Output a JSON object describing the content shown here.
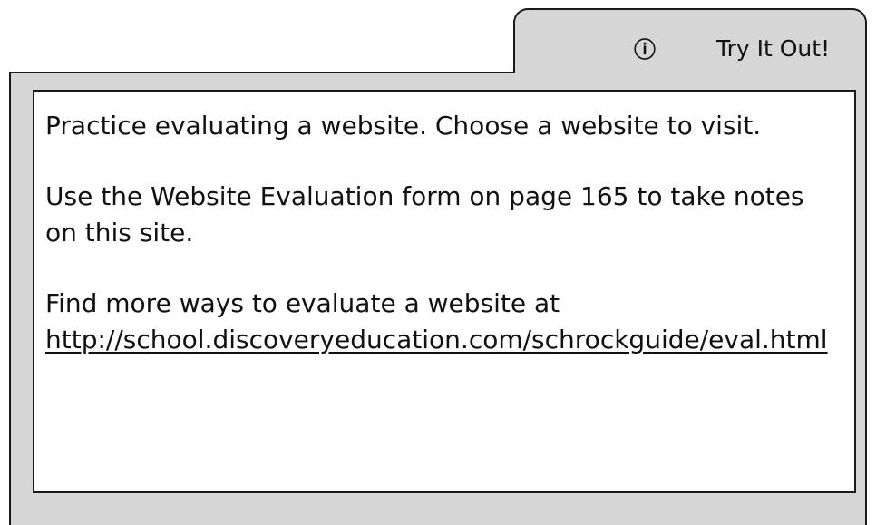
{
  "tab": {
    "icon": "info-icon",
    "icon_glyph": "ⓘ",
    "title": "Try It Out!"
  },
  "content": {
    "paragraph_1": "Practice evaluating a website. Choose a website to visit.",
    "paragraph_2": "Use the Website Evaluation form on page 165 to take notes on this site.",
    "paragraph_3_text": "Find more ways to evaluate a website at",
    "link_text": "http://school.discoveryeducation.com/schrockguide/eval.html"
  },
  "colors": {
    "panel_gray": "#d6d6d6",
    "border": "#1a1a1a",
    "text": "#111111"
  }
}
